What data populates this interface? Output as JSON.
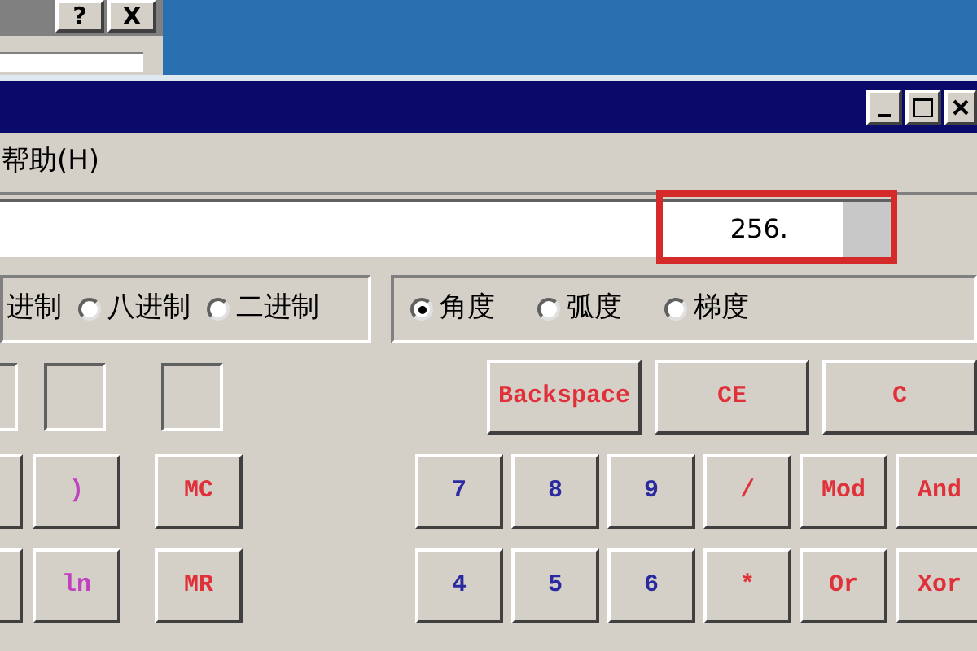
{
  "dialog": {
    "buttons": [
      "?",
      "X"
    ]
  },
  "menu": [
    "帮助(H)"
  ],
  "display": {
    "value": "256.",
    "highlighted": true
  },
  "number_system": {
    "cut_label": "进制",
    "options": [
      {
        "label": "八进制",
        "selected": false
      },
      {
        "label": "二进制",
        "selected": false
      }
    ]
  },
  "angle_units": [
    {
      "label": "角度",
      "selected": true
    },
    {
      "label": "弧度",
      "selected": false
    },
    {
      "label": "梯度",
      "selected": false
    }
  ],
  "edit_buttons": [
    {
      "label": "Backspace",
      "color": "#e0303a"
    },
    {
      "label": "CE",
      "color": "#e0303a"
    },
    {
      "label": "C",
      "color": "#e0303a"
    }
  ],
  "rows": [
    {
      "left": [
        {
          "kind": "blank"
        },
        {
          "kind": "key",
          "label": ")",
          "color": "#c040c0"
        }
      ],
      "memory": {
        "label": "MC",
        "color": "#e0303a"
      },
      "main": [
        {
          "label": "7",
          "color": "#2a2aa0"
        },
        {
          "label": "8",
          "color": "#2a2aa0"
        },
        {
          "label": "9",
          "color": "#2a2aa0"
        },
        {
          "label": "/",
          "color": "#e0303a"
        },
        {
          "label": "Mod",
          "color": "#e0303a"
        },
        {
          "label": "And",
          "color": "#e0303a"
        }
      ]
    },
    {
      "left": [
        {
          "kind": "blank"
        },
        {
          "kind": "key",
          "label": "ln",
          "color": "#c040c0"
        }
      ],
      "memory": {
        "label": "MR",
        "color": "#e0303a"
      },
      "main": [
        {
          "label": "4",
          "color": "#2a2aa0"
        },
        {
          "label": "5",
          "color": "#2a2aa0"
        },
        {
          "label": "6",
          "color": "#2a2aa0"
        },
        {
          "label": "*",
          "color": "#e0303a"
        },
        {
          "label": "Or",
          "color": "#e0303a"
        },
        {
          "label": "Xor",
          "color": "#e0303a"
        }
      ]
    }
  ]
}
